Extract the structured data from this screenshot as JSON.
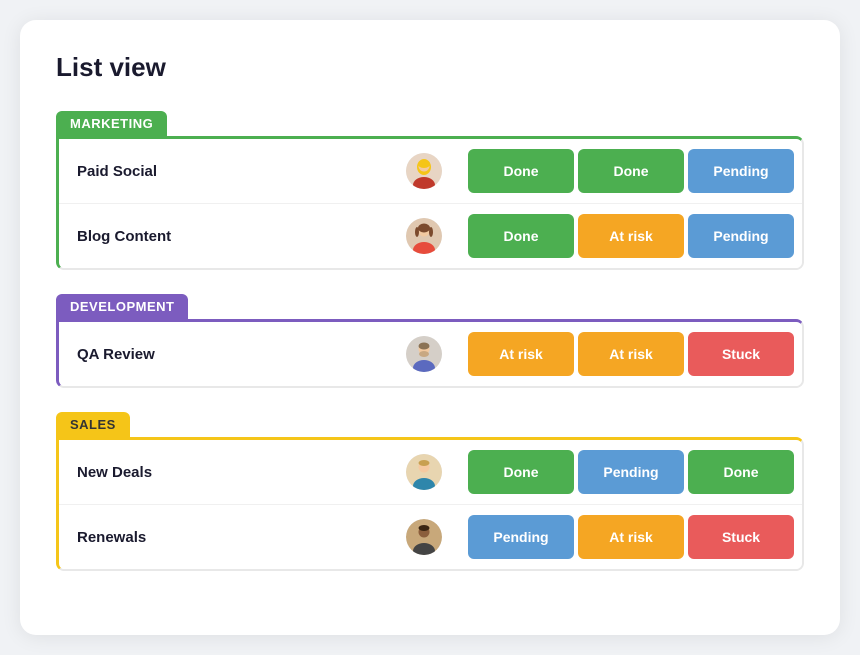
{
  "page": {
    "title": "List view"
  },
  "groups": [
    {
      "id": "marketing",
      "label": "MARKETING",
      "theme": "marketing",
      "rows": [
        {
          "name": "Paid Social",
          "avatar_id": "blonde-woman",
          "statuses": [
            {
              "label": "Done",
              "type": "done"
            },
            {
              "label": "Done",
              "type": "done"
            },
            {
              "label": "Pending",
              "type": "pending"
            }
          ]
        },
        {
          "name": "Blog Content",
          "avatar_id": "brunette-woman",
          "statuses": [
            {
              "label": "Done",
              "type": "done"
            },
            {
              "label": "At risk",
              "type": "at-risk"
            },
            {
              "label": "Pending",
              "type": "pending"
            }
          ]
        }
      ]
    },
    {
      "id": "development",
      "label": "DEVELOPMENT",
      "theme": "development",
      "rows": [
        {
          "name": "QA Review",
          "avatar_id": "bearded-man",
          "statuses": [
            {
              "label": "At risk",
              "type": "at-risk"
            },
            {
              "label": "At risk",
              "type": "at-risk"
            },
            {
              "label": "Stuck",
              "type": "stuck"
            }
          ]
        }
      ]
    },
    {
      "id": "sales",
      "label": "SALES",
      "theme": "sales",
      "rows": [
        {
          "name": "New Deals",
          "avatar_id": "light-skin-man",
          "statuses": [
            {
              "label": "Done",
              "type": "done"
            },
            {
              "label": "Pending",
              "type": "pending"
            },
            {
              "label": "Done",
              "type": "done"
            }
          ]
        },
        {
          "name": "Renewals",
          "avatar_id": "dark-skin-man",
          "statuses": [
            {
              "label": "Pending",
              "type": "pending"
            },
            {
              "label": "At risk",
              "type": "at-risk"
            },
            {
              "label": "Stuck",
              "type": "stuck"
            }
          ]
        }
      ]
    }
  ],
  "status_colors": {
    "done": "#4caf50",
    "pending": "#5b9bd5",
    "at-risk": "#f5a623",
    "stuck": "#e95b5b"
  }
}
